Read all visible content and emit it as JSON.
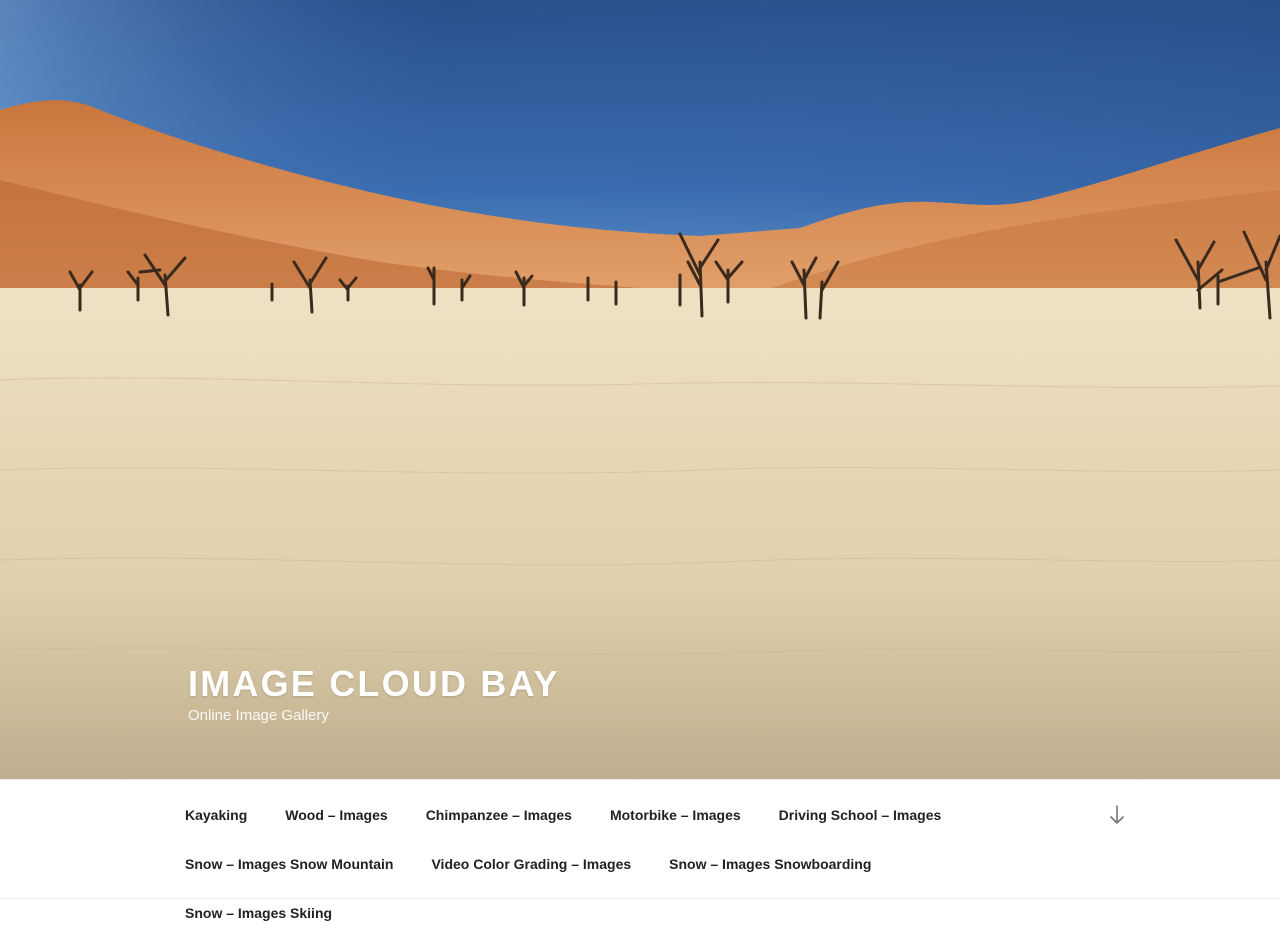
{
  "site": {
    "title": "Image Cloud Bay",
    "tagline": "Online Image Gallery"
  },
  "hero": {
    "image_description_icon": "desert-landscape-image",
    "sky_color": "#2f5d9c",
    "dune_color": "#d98b52",
    "ground_color": "#e8d8b6"
  },
  "nav": {
    "items": [
      {
        "label": "Kayaking"
      },
      {
        "label": "Wood – Images"
      },
      {
        "label": "Chimpanzee – Images"
      },
      {
        "label": "Motorbike – Images"
      },
      {
        "label": "Driving School – Images"
      },
      {
        "label": "Snow – Images Snow Mountain"
      },
      {
        "label": "Video Color Grading – Images"
      },
      {
        "label": "Snow – Images Snowboarding"
      },
      {
        "label": "Snow – Images Skiing"
      }
    ],
    "scroll_icon": "arrow-down-icon"
  }
}
